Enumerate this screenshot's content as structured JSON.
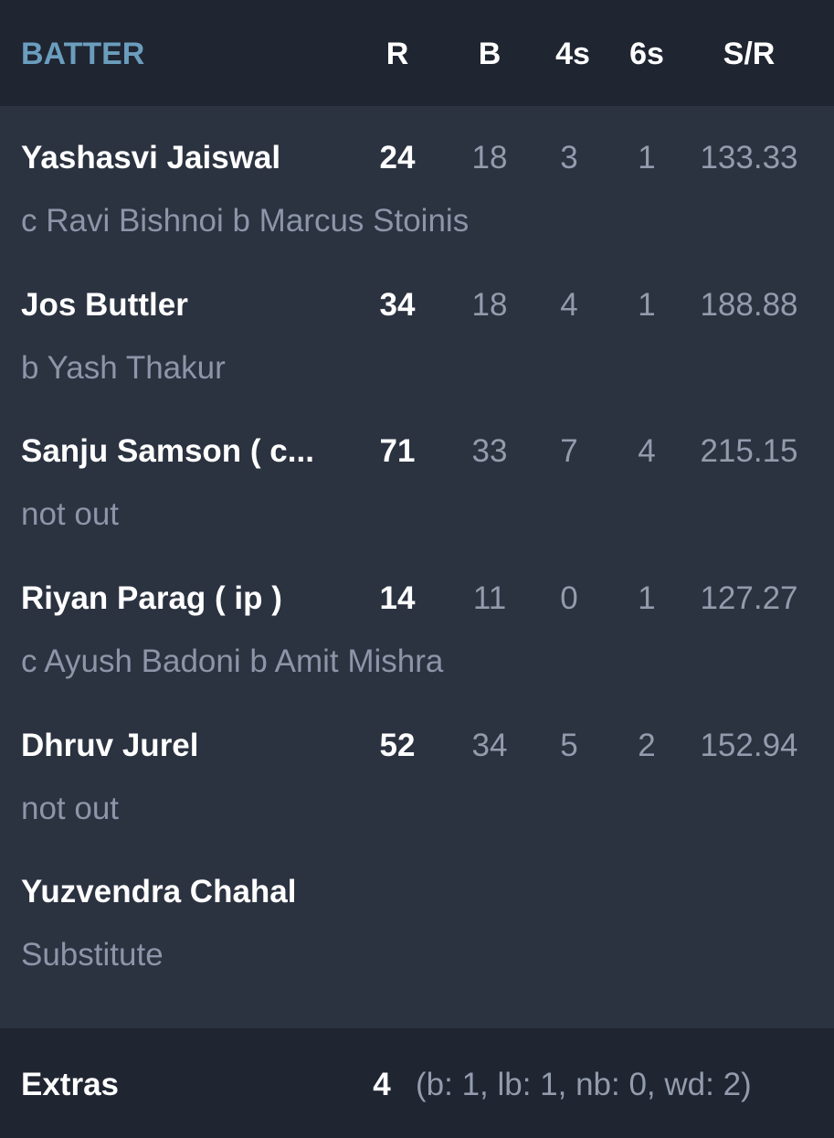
{
  "header": {
    "batter": "BATTER",
    "runs": "R",
    "balls": "B",
    "fours": "4s",
    "sixes": "6s",
    "strike_rate": "S/R"
  },
  "batters": [
    {
      "name": "Yashasvi Jaiswal",
      "dismissal": "c Ravi Bishnoi b Marcus Stoinis",
      "runs": "24",
      "balls": "18",
      "fours": "3",
      "sixes": "1",
      "sr": "133.33"
    },
    {
      "name": "Jos Buttler",
      "dismissal": "b Yash Thakur",
      "runs": "34",
      "balls": "18",
      "fours": "4",
      "sixes": "1",
      "sr": "188.88"
    },
    {
      "name": "Sanju Samson ( c...",
      "dismissal": "not out",
      "runs": "71",
      "balls": "33",
      "fours": "7",
      "sixes": "4",
      "sr": "215.15"
    },
    {
      "name": "Riyan Parag ( ip )",
      "dismissal": "c Ayush Badoni b Amit Mishra",
      "runs": "14",
      "balls": "11",
      "fours": "0",
      "sixes": "1",
      "sr": "127.27"
    },
    {
      "name": "Dhruv Jurel",
      "dismissal": "not out",
      "runs": "52",
      "balls": "34",
      "fours": "5",
      "sixes": "2",
      "sr": "152.94"
    },
    {
      "name": "Yuzvendra Chahal",
      "dismissal": "Substitute",
      "runs": "",
      "balls": "",
      "fours": "",
      "sixes": "",
      "sr": ""
    }
  ],
  "extras": {
    "label": "Extras",
    "total": "4",
    "detail": "(b: 1, lb: 1, nb: 0, wd: 2)"
  },
  "colors": {
    "header_bg": "#1f2531",
    "list_bg": "#2b3240",
    "accent": "#6b9dbd",
    "muted_text": "#8c96a8"
  }
}
